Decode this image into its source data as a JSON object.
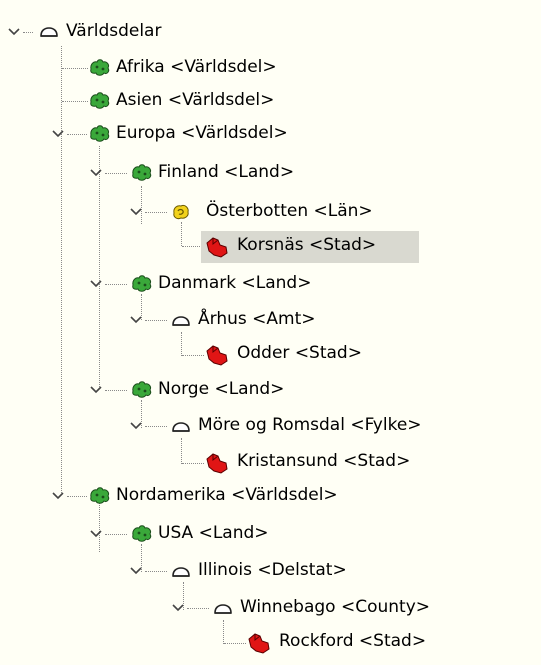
{
  "tree": {
    "root": {
      "label": "Världsdelar",
      "icon": "cloud-outline-icon"
    },
    "nodes": [
      {
        "label": "Afrika <Världsdel>",
        "icon": "green-map-icon"
      },
      {
        "label": "Asien <Världsdel>",
        "icon": "green-map-icon"
      },
      {
        "label": "Europa <Världsdel>",
        "icon": "green-map-icon"
      },
      {
        "label": "Finland <Land>",
        "icon": "green-map-icon"
      },
      {
        "label": "Österbotten <Län>",
        "icon": "yellow-map-icon"
      },
      {
        "label": "Korsnäs <Stad>",
        "icon": "red-map-icon",
        "selected": true
      },
      {
        "label": "Danmark <Land>",
        "icon": "green-map-icon"
      },
      {
        "label": "Århus <Amt>",
        "icon": "cloud-outline-icon"
      },
      {
        "label": "Odder <Stad>",
        "icon": "red-map-icon"
      },
      {
        "label": "Norge <Land>",
        "icon": "green-map-icon"
      },
      {
        "label": "Möre og Romsdal <Fylke>",
        "icon": "cloud-outline-icon"
      },
      {
        "label": "Kristansund <Stad>",
        "icon": "red-map-icon"
      },
      {
        "label": "Nordamerika <Världsdel>",
        "icon": "green-map-icon"
      },
      {
        "label": "USA <Land>",
        "icon": "green-map-icon"
      },
      {
        "label": "Illinois <Delstat>",
        "icon": "cloud-outline-icon"
      },
      {
        "label": "Winnebago <County>",
        "icon": "cloud-outline-icon"
      },
      {
        "label": "Rockford <Stad>",
        "icon": "red-map-icon"
      }
    ]
  },
  "colors": {
    "background": "#fffff5",
    "selection": "#d9d9d0",
    "continent_green": "#3aa83a",
    "region_yellow": "#f2d21b",
    "city_red": "#e01515"
  }
}
